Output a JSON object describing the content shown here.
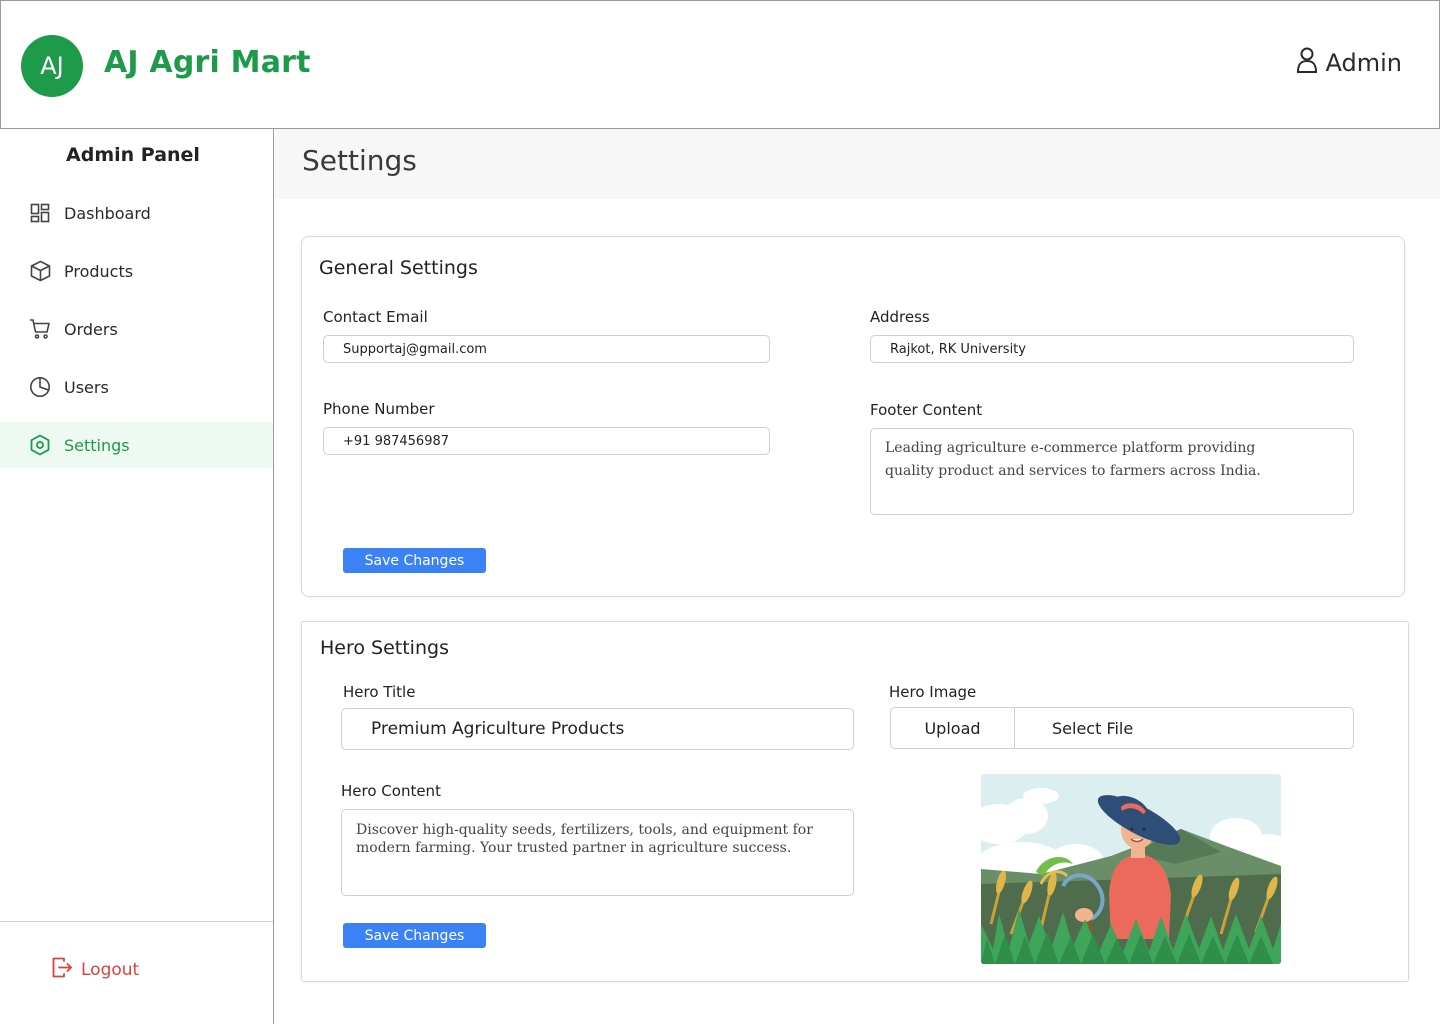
{
  "header": {
    "logo_initials": "AJ",
    "brand_name": "AJ Agri Mart",
    "user_label": "Admin"
  },
  "sidebar": {
    "title": "Admin Panel",
    "items": [
      {
        "label": "Dashboard",
        "icon": "dashboard-grid-icon"
      },
      {
        "label": "Products",
        "icon": "box-icon"
      },
      {
        "label": "Orders",
        "icon": "cart-icon"
      },
      {
        "label": "Users",
        "icon": "pie-chart-icon"
      },
      {
        "label": "Settings",
        "icon": "settings-hexagon-icon",
        "active": true
      }
    ],
    "logout_label": "Logout"
  },
  "page": {
    "title": "Settings"
  },
  "general_settings": {
    "title": "General Settings",
    "contact_email_label": "Contact Email",
    "contact_email_value": "Supportaj@gmail.com",
    "address_label": "Address",
    "address_value": "Rajkot, RK University",
    "phone_label": "Phone Number",
    "phone_value": "+91 987456987",
    "footer_label": "Footer Content",
    "footer_value": "Leading agriculture e-commerce  platform providing quality product and services to farmers across India.",
    "save_label": "Save Changes"
  },
  "hero_settings": {
    "title": "Hero Settings",
    "hero_title_label": "Hero Title",
    "hero_title_value": "Premium Agriculture Products",
    "hero_image_label": "Hero Image",
    "upload_label": "Upload",
    "select_file_label": "Select File",
    "hero_content_label": "Hero Content",
    "hero_content_value": "Discover high-quality seeds, fertilizers, tools, and equipment for modern farming. Your trusted partner in agriculture success.",
    "save_label": "Save Changes"
  },
  "colors": {
    "brand_green": "#1e9b4a",
    "active_bg": "#eefaf1",
    "button_blue": "#3b82f6",
    "logout_red": "#e0403a"
  }
}
